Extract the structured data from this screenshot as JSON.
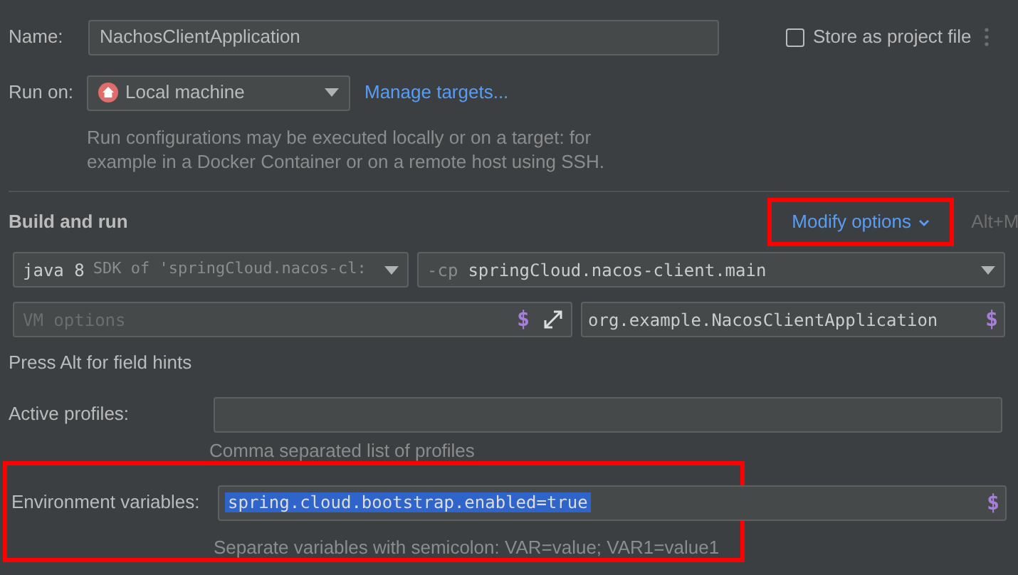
{
  "name": {
    "label": "Name:",
    "value": "NachosClientApplication"
  },
  "store_as_project_file": {
    "label": "Store as project file",
    "checked": false
  },
  "run_on": {
    "label": "Run on:",
    "value": "Local machine",
    "link": "Manage targets...",
    "hint": "Run configurations may be executed locally or on a target: for example in a Docker Container or on a remote host using SSH."
  },
  "build_and_run": {
    "title": "Build and run",
    "modify_options": {
      "label": "Modify options",
      "shortcut": "Alt+M",
      "highlighted": true
    },
    "jre": {
      "value": "java 8",
      "detail": "SDK of 'springCloud.nacos-cl:"
    },
    "classpath": {
      "prefix": "-cp",
      "value": "springCloud.nacos-client.main"
    },
    "vm_options": {
      "placeholder": "VM options",
      "macro": "$"
    },
    "main_class": {
      "value": "org.example.NacosClientApplication",
      "macro": "$"
    },
    "hint": "Press Alt for field hints"
  },
  "active_profiles": {
    "label": "Active profiles:",
    "hint": "Comma separated list of profiles"
  },
  "environment_variables": {
    "label": "Environment variables:",
    "value": "spring.cloud.bootstrap.enabled=true",
    "selected": true,
    "macro": "$",
    "hint": "Separate variables with semicolon: VAR=value; VAR1=value1",
    "highlighted": true
  }
}
